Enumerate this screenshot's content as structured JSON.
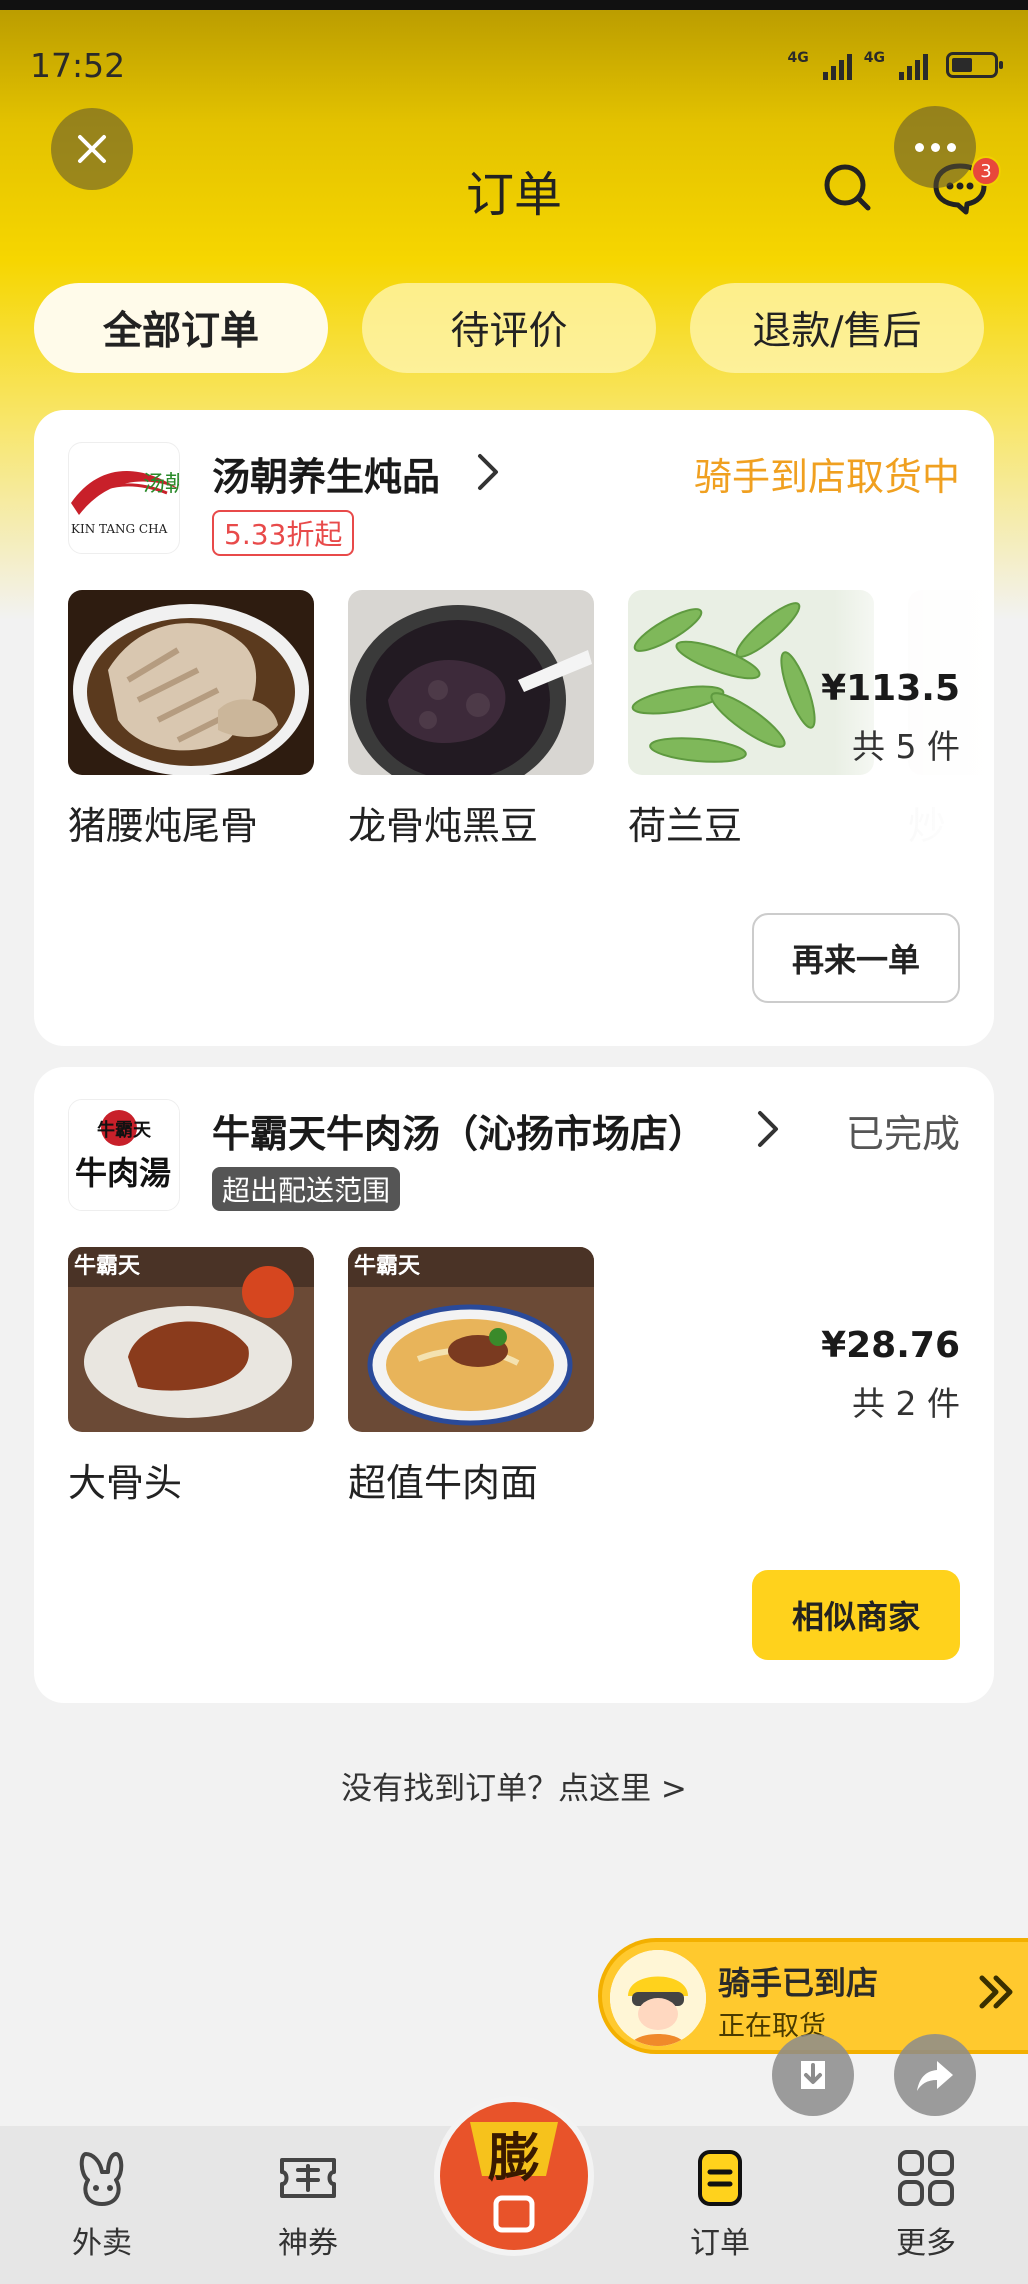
{
  "status_bar": {
    "time": "17:52",
    "net1": "4G",
    "net2": "4G"
  },
  "header": {
    "title": "订单",
    "chat_badge": "3"
  },
  "tabs": [
    {
      "label": "全部订单",
      "active": true
    },
    {
      "label": "待评价",
      "active": false
    },
    {
      "label": "退款/售后",
      "active": false
    }
  ],
  "orders": [
    {
      "shop_name": "汤朝养生炖品",
      "logo_text": "汤朝",
      "logo_subtext": "KIN TANG CHA",
      "status": "骑手到店取货中",
      "tag": "5.33折起",
      "items": [
        {
          "name": "猪腰炖尾骨"
        },
        {
          "name": "龙骨炖黑豆"
        },
        {
          "name": "荷兰豆"
        },
        {
          "name": "炒"
        }
      ],
      "price": "¥113.5",
      "count": "共 5 件",
      "action": "再来一单"
    },
    {
      "shop_name": "牛霸天牛肉汤（沁扬市场店）",
      "logo_text": "牛肉湯",
      "logo_subtext": "牛霸天",
      "status": "已完成",
      "tag": "超出配送范围",
      "items": [
        {
          "name": "大骨头",
          "overlay": "牛霸天"
        },
        {
          "name": "超值牛肉面",
          "overlay": "牛霸天"
        }
      ],
      "price": "¥28.76",
      "count": "共 2 件",
      "action": "相似商家"
    }
  ],
  "footer": {
    "not_found": "没有找到订单？点这里 >"
  },
  "rider_banner": {
    "title": "骑手已到店",
    "subtitle": "正在取货"
  },
  "bottom_nav": [
    {
      "label": "外卖",
      "active": false
    },
    {
      "label": "神券",
      "active": false
    },
    {
      "label": "膨",
      "active": false
    },
    {
      "label": "订单",
      "active": true
    },
    {
      "label": "更多",
      "active": false
    }
  ],
  "colors": {
    "accent": "#ffd21c",
    "status_orange": "#f0a020",
    "promo_red": "#e84a4a"
  }
}
